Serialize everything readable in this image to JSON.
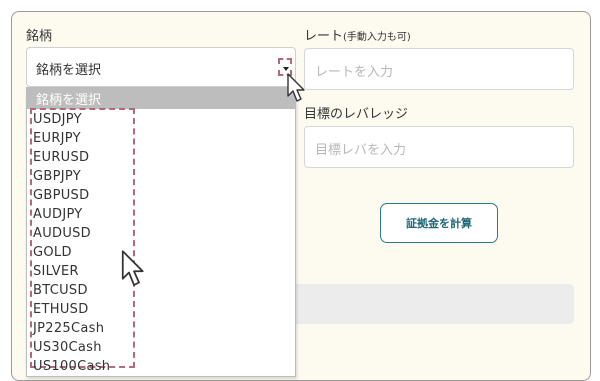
{
  "form": {
    "symbol_label": "銘柄",
    "symbol_select": {
      "selected": "銘柄を選択"
    },
    "rate_label": "レート",
    "rate_note": "(手動入力も可)",
    "rate_placeholder": "レートを入力",
    "leverage_label": "目標のレバレッジ",
    "leverage_placeholder": "目標レバを入力",
    "calculate_button": "証拠金を計算"
  },
  "dropdown": {
    "header": "銘柄を選択",
    "options": [
      "USDJPY",
      "EURJPY",
      "EURUSD",
      "GBPJPY",
      "GBPUSD",
      "AUDJPY",
      "AUDUSD",
      "GOLD",
      "SILVER",
      "BTCUSD",
      "ETHUSD",
      "JP225Cash",
      "US30Cash",
      "US100Cash"
    ]
  },
  "annotation_color": "#b06a7a"
}
